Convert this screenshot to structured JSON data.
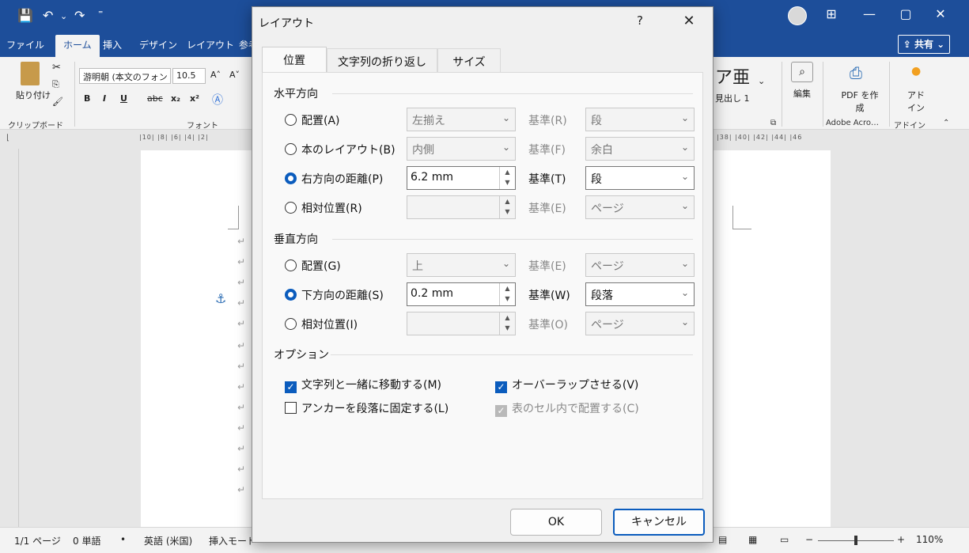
{
  "titlebar": {
    "quick_access": [
      "💾",
      "↶",
      "⌄",
      "↷",
      "⁼"
    ],
    "controls": [
      "⊞",
      "—",
      "▢",
      "✕"
    ]
  },
  "ribbon_tabs": [
    "ファイル",
    "ホーム",
    "挿入",
    "デザイン",
    "レイアウト",
    "参考"
  ],
  "share_label": "共有",
  "ribbon": {
    "paste_label": "貼り付け",
    "clipboard_group": "クリップボード",
    "font_name": "游明朝 (本文のフォン",
    "font_size": "10.5",
    "font_group": "フォント",
    "style_sample": "ア亜",
    "style_name": "見出し 1",
    "edit_label": "編集",
    "pdf_label": "PDF を作成",
    "adobe_group": "Adobe Acro…",
    "addin_label": "アド イン",
    "addin_group": "アドイン"
  },
  "ruler": {
    "left": "|10|  |8|  |6|  |4|  |2|",
    "right": "|38|  |40|  |42|  |44|  |46"
  },
  "status": {
    "page": "1/1 ページ",
    "words": "0 単語",
    "lang": "英語 (米国)",
    "mode": "挿入モード",
    "zoom": "110%"
  },
  "dialog": {
    "title": "レイアウト",
    "help": "?",
    "close": "✕",
    "tabs": [
      "位置",
      "文字列の折り返し",
      "サイズ"
    ],
    "horizontal": {
      "heading": "水平方向",
      "rows": [
        {
          "label": "配置(A)",
          "value": "左揃え",
          "base_label": "基準(R)",
          "base_value": "段"
        },
        {
          "label": "本のレイアウト(B)",
          "value": "内側",
          "base_label": "基準(F)",
          "base_value": "余白"
        },
        {
          "label": "右方向の距離(P)",
          "value": "6.2 mm",
          "base_label": "基準(T)",
          "base_value": "段"
        },
        {
          "label": "相対位置(R)",
          "value": "",
          "base_label": "基準(E)",
          "base_value": "ページ"
        }
      ]
    },
    "vertical": {
      "heading": "垂直方向",
      "rows": [
        {
          "label": "配置(G)",
          "value": "上",
          "base_label": "基準(E)",
          "base_value": "ページ"
        },
        {
          "label": "下方向の距離(S)",
          "value": "0.2 mm",
          "base_label": "基準(W)",
          "base_value": "段落"
        },
        {
          "label": "相対位置(I)",
          "value": "",
          "base_label": "基準(O)",
          "base_value": "ページ"
        }
      ]
    },
    "options": {
      "heading": "オプション",
      "move_with_text": "文字列と一緒に移動する(M)",
      "allow_overlap": "オーバーラップさせる(V)",
      "lock_anchor": "アンカーを段落に固定する(L)",
      "layout_in_cell": "表のセル内で配置する(C)"
    },
    "ok": "OK",
    "cancel": "キャンセル"
  }
}
